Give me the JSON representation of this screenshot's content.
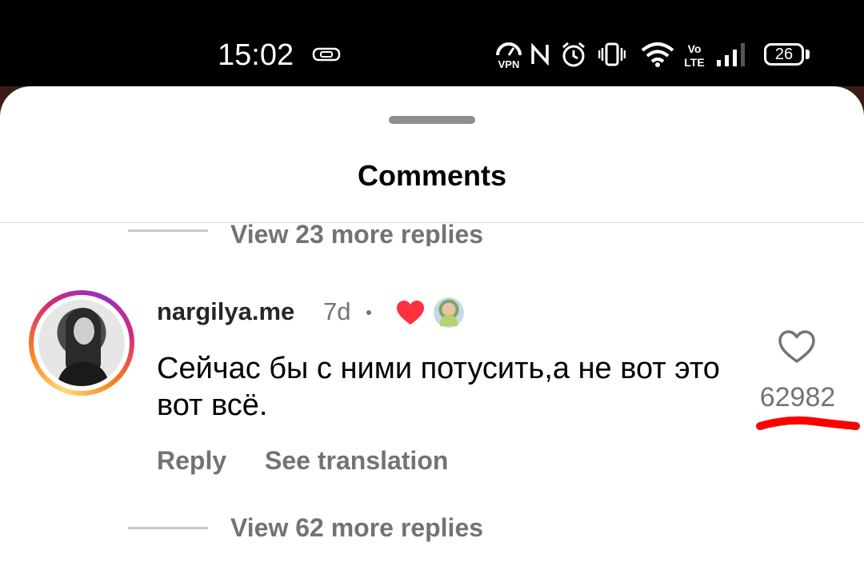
{
  "status_bar": {
    "time": "15:02",
    "battery_level": "26",
    "icons": [
      "cast-icon",
      "vpn-icon",
      "nfc-icon",
      "alarm-icon",
      "vibrate-icon",
      "wifi-icon",
      "volte-icon",
      "signal-icon",
      "battery-icon"
    ]
  },
  "sheet": {
    "title": "Comments"
  },
  "replies_above": {
    "label": "View 23 more replies"
  },
  "comment": {
    "username": "nargilya.me",
    "age": "7d",
    "text": "Сейчас бы с ними потусить,а не вот это вот всё.",
    "reply_label": "Reply",
    "translate_label": "See translation",
    "like_count": "62982",
    "creator_like": "heart-icon"
  },
  "replies_below": {
    "label": "View 62 more replies"
  },
  "colors": {
    "heart_red": "#ff3040",
    "annotation_red": "#ff0000",
    "muted_text": "#737373"
  }
}
